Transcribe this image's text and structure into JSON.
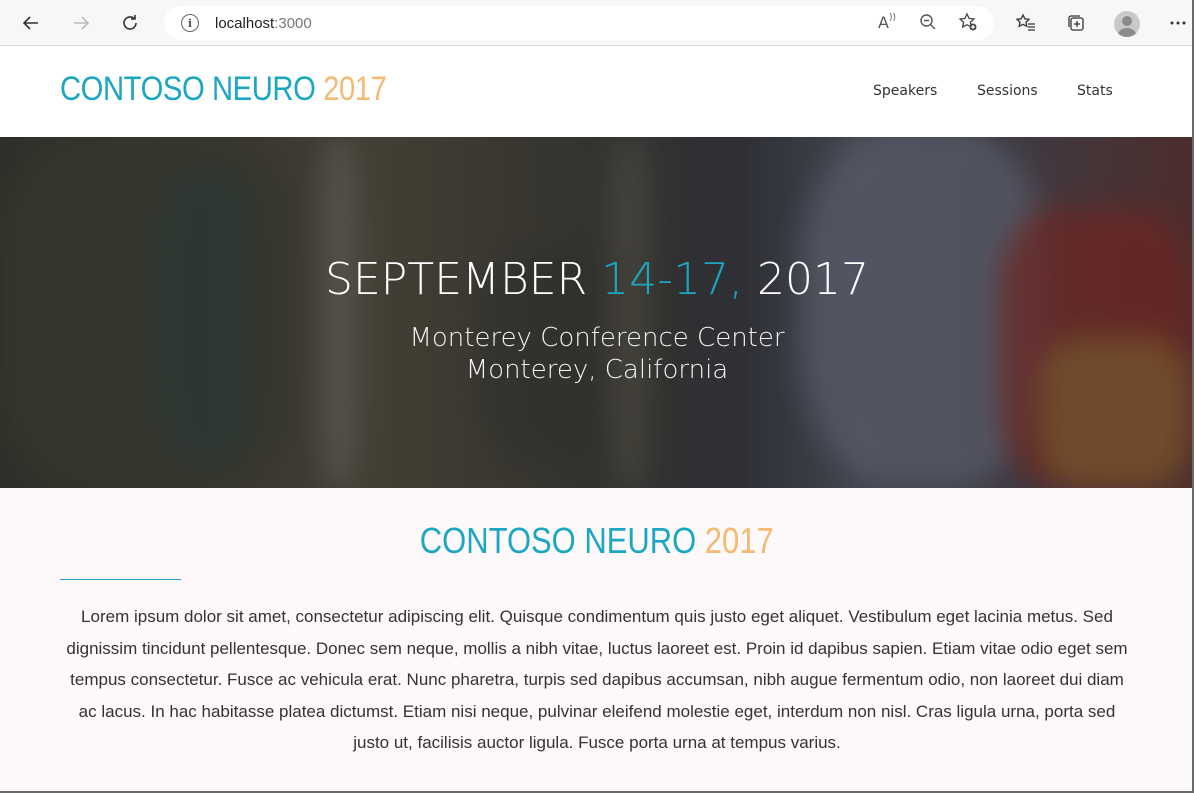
{
  "browser": {
    "url_host": "localhost",
    "url_port": ":3000",
    "icons": {
      "back": "arrow-left-icon",
      "forward": "arrow-right-icon",
      "refresh": "refresh-icon",
      "info": "info-icon",
      "read_aloud": "read-aloud-icon",
      "zoom": "zoom-out-icon",
      "add_favorite": "star-add-icon",
      "favorites": "favorites-list-icon",
      "collections": "collections-icon",
      "profile": "profile-avatar",
      "more": "more-icon"
    }
  },
  "site": {
    "logo_brand": "CONTOSO NEURO ",
    "logo_year": "2017",
    "nav": [
      "Speakers",
      "Sessions",
      "Stats"
    ]
  },
  "hero": {
    "date_prefix": "SEPTEMBER ",
    "date_highlight": "14-17,",
    "date_suffix": " 2017",
    "venue": "Monterey Conference Center",
    "location": "Monterey, California"
  },
  "about": {
    "title_brand": "CONTOSO NEURO ",
    "title_year": "2017",
    "body": "Lorem ipsum dolor sit amet, consectetur adipiscing elit. Quisque condimentum quis justo eget aliquet. Vestibulum eget lacinia metus. Sed dignissim tincidunt pellentesque. Donec sem neque, mollis a nibh vitae, luctus laoreet est. Proin id dapibus sapien. Etiam vitae odio eget sem tempus consectetur. Fusce ac vehicula erat. Nunc pharetra, turpis sed dapibus accumsan, nibh augue fermentum odio, non laoreet dui diam ac lacus. In hac habitasse platea dictumst. Etiam nisi neque, pulvinar eleifend molestie eget, interdum non nisl. Cras ligula urna, porta sed justo ut, facilisis auctor ligula. Fusce porta urna at tempus varius."
  },
  "colors": {
    "accent": "#1ba7c4",
    "year": "#f5b971"
  }
}
